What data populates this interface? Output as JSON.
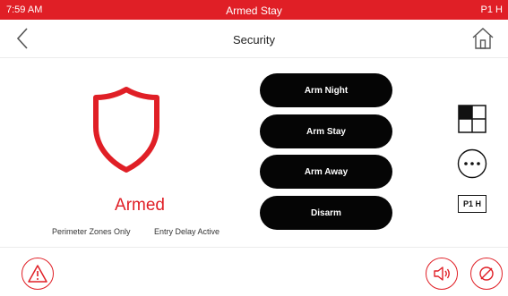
{
  "status_bar": {
    "time": "7:59 AM",
    "mode": "Armed Stay",
    "partition": "P1 H"
  },
  "header": {
    "title": "Security"
  },
  "status_panel": {
    "state": "Armed",
    "zone_note": "Perimeter Zones Only",
    "delay_note": "Entry Delay Active",
    "accent_color": "#e01f26"
  },
  "arm_buttons": [
    {
      "label": "Arm Night"
    },
    {
      "label": "Arm Stay"
    },
    {
      "label": "Arm Away"
    },
    {
      "label": "Disarm"
    }
  ],
  "side_panel": {
    "partition_badge": "P1 H",
    "icons": [
      "layout-grid-icon",
      "more-options-icon"
    ]
  },
  "bottom_bar": {
    "icons": [
      "panic-alert-icon",
      "chime-speaker-icon",
      "mute-icon"
    ]
  }
}
